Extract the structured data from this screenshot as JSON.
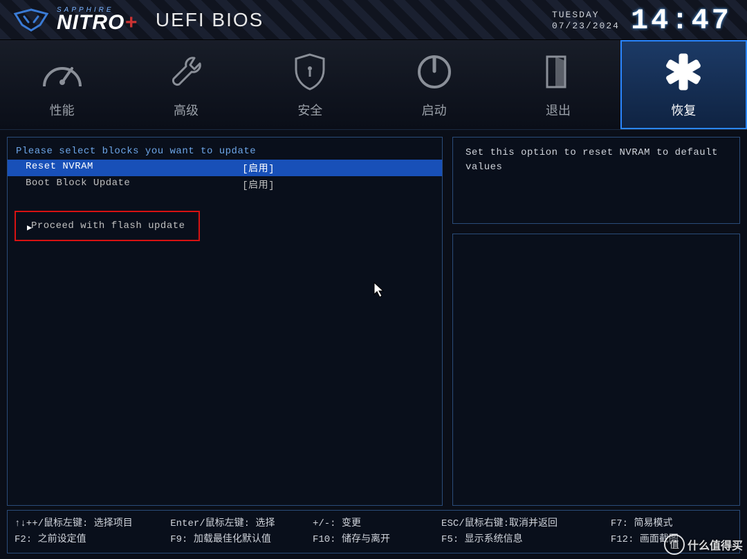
{
  "header": {
    "brand_small": "SAPPHIRE",
    "brand_main": "NITRO",
    "brand_plus": "+",
    "title": "UEFI BIOS",
    "day": "TUESDAY",
    "date": "07/23/2024",
    "time": "14:47"
  },
  "nav": {
    "items": [
      {
        "label": "性能",
        "icon": "gauge-icon"
      },
      {
        "label": "高级",
        "icon": "wrench-icon"
      },
      {
        "label": "安全",
        "icon": "shield-icon"
      },
      {
        "label": "启动",
        "icon": "power-icon"
      },
      {
        "label": "退出",
        "icon": "exit-icon"
      },
      {
        "label": "恢复",
        "icon": "recovery-icon"
      }
    ],
    "active_index": 5
  },
  "main": {
    "instruction": "Please select blocks you want to update",
    "options": [
      {
        "name": "Reset NVRAM",
        "value": "[启用]",
        "selected": true
      },
      {
        "name": "Boot Block Update",
        "value": "[启用]",
        "selected": false
      }
    ],
    "proceed_label": "Proceed with flash update"
  },
  "help": {
    "text": "Set this option to reset NVRAM to default values"
  },
  "footer": {
    "c1a": "↑↓++/鼠标左键: 选择项目",
    "c1b": "F2: 之前设定值",
    "c2a": "Enter/鼠标左键: 选择",
    "c2b": "F9: 加载最佳化默认值",
    "c3a": "+/-: 变更",
    "c3b": "F10: 储存与离开",
    "c4a": "ESC/鼠标右键:取消并返回",
    "c4b": "F5: 显示系统信息",
    "c5a": "F7: 简易模式",
    "c5b": "F12: 画面截图"
  },
  "watermark": {
    "badge": "值",
    "text": "什么值得买"
  }
}
